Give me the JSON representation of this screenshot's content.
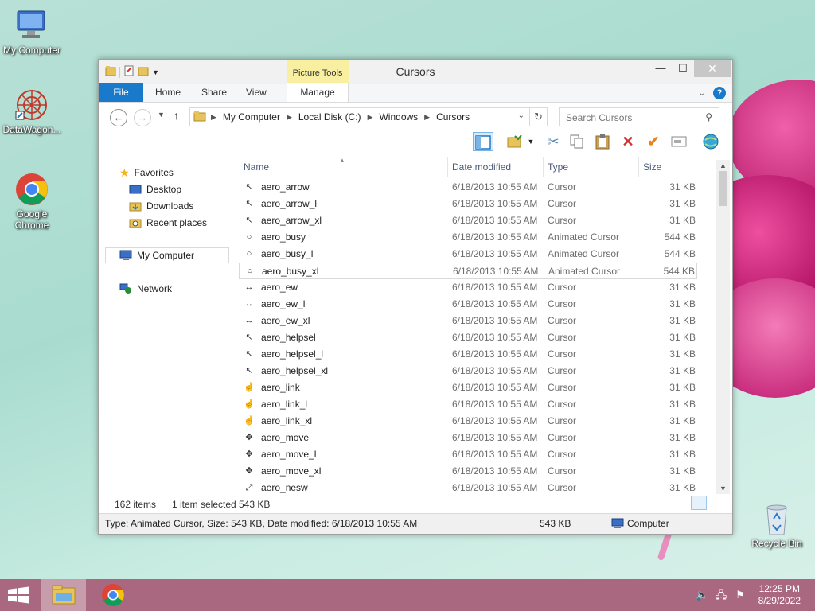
{
  "desktop": {
    "icons": [
      {
        "label": "My Computer"
      },
      {
        "label": "DataWagon..."
      },
      {
        "label": "Google Chrome"
      },
      {
        "label": "Recycle Bin"
      }
    ]
  },
  "window": {
    "title": "Cursors",
    "picture_tools": "Picture Tools",
    "controls": {
      "minimize": "—",
      "maximize": "☐",
      "close": "✕"
    },
    "tabs": [
      "File",
      "Home",
      "Share",
      "View",
      "Manage"
    ],
    "help": "?",
    "address": {
      "crumbs": [
        "My Computer",
        "Local Disk (C:)",
        "Windows",
        "Cursors"
      ]
    },
    "search": {
      "placeholder": "Search Cursors"
    },
    "nav": {
      "favorites": "Favorites",
      "items": [
        "Desktop",
        "Downloads",
        "Recent places"
      ],
      "computer": "My Computer",
      "network": "Network"
    },
    "columns": {
      "name": "Name",
      "date": "Date modified",
      "type": "Type",
      "size": "Size"
    },
    "files": [
      {
        "name": "aero_arrow",
        "date": "6/18/2013 10:55 AM",
        "type": "Cursor",
        "size": "31 KB",
        "icon": "↖"
      },
      {
        "name": "aero_arrow_l",
        "date": "6/18/2013 10:55 AM",
        "type": "Cursor",
        "size": "31 KB",
        "icon": "↖"
      },
      {
        "name": "aero_arrow_xl",
        "date": "6/18/2013 10:55 AM",
        "type": "Cursor",
        "size": "31 KB",
        "icon": "↖"
      },
      {
        "name": "aero_busy",
        "date": "6/18/2013 10:55 AM",
        "type": "Animated Cursor",
        "size": "544 KB",
        "icon": "○"
      },
      {
        "name": "aero_busy_l",
        "date": "6/18/2013 10:55 AM",
        "type": "Animated Cursor",
        "size": "544 KB",
        "icon": "○"
      },
      {
        "name": "aero_busy_xl",
        "date": "6/18/2013 10:55 AM",
        "type": "Animated Cursor",
        "size": "544 KB",
        "icon": "○"
      },
      {
        "name": "aero_ew",
        "date": "6/18/2013 10:55 AM",
        "type": "Cursor",
        "size": "31 KB",
        "icon": "↔"
      },
      {
        "name": "aero_ew_l",
        "date": "6/18/2013 10:55 AM",
        "type": "Cursor",
        "size": "31 KB",
        "icon": "↔"
      },
      {
        "name": "aero_ew_xl",
        "date": "6/18/2013 10:55 AM",
        "type": "Cursor",
        "size": "31 KB",
        "icon": "↔"
      },
      {
        "name": "aero_helpsel",
        "date": "6/18/2013 10:55 AM",
        "type": "Cursor",
        "size": "31 KB",
        "icon": "↖"
      },
      {
        "name": "aero_helpsel_l",
        "date": "6/18/2013 10:55 AM",
        "type": "Cursor",
        "size": "31 KB",
        "icon": "↖"
      },
      {
        "name": "aero_helpsel_xl",
        "date": "6/18/2013 10:55 AM",
        "type": "Cursor",
        "size": "31 KB",
        "icon": "↖"
      },
      {
        "name": "aero_link",
        "date": "6/18/2013 10:55 AM",
        "type": "Cursor",
        "size": "31 KB",
        "icon": "☝"
      },
      {
        "name": "aero_link_l",
        "date": "6/18/2013 10:55 AM",
        "type": "Cursor",
        "size": "31 KB",
        "icon": "☝"
      },
      {
        "name": "aero_link_xl",
        "date": "6/18/2013 10:55 AM",
        "type": "Cursor",
        "size": "31 KB",
        "icon": "☝"
      },
      {
        "name": "aero_move",
        "date": "6/18/2013 10:55 AM",
        "type": "Cursor",
        "size": "31 KB",
        "icon": "✥"
      },
      {
        "name": "aero_move_l",
        "date": "6/18/2013 10:55 AM",
        "type": "Cursor",
        "size": "31 KB",
        "icon": "✥"
      },
      {
        "name": "aero_move_xl",
        "date": "6/18/2013 10:55 AM",
        "type": "Cursor",
        "size": "31 KB",
        "icon": "✥"
      },
      {
        "name": "aero_nesw",
        "date": "6/18/2013 10:55 AM",
        "type": "Cursor",
        "size": "31 KB",
        "icon": "⤢"
      }
    ],
    "selected_index": 5,
    "status": {
      "items": "162 items",
      "selected": "1 item selected",
      "selsize": "543 KB"
    },
    "statusbar": {
      "detail": "Type: Animated Cursor, Size: 543 KB, Date modified: 6/18/2013 10:55 AM",
      "size": "543 KB",
      "location": "Computer"
    }
  },
  "taskbar": {
    "time": "12:25 PM",
    "date": "8/29/2022"
  },
  "colors": {
    "accent": "#1979ca",
    "taskbar": "#a9687f",
    "picture_tools": "#f8f0a0"
  }
}
